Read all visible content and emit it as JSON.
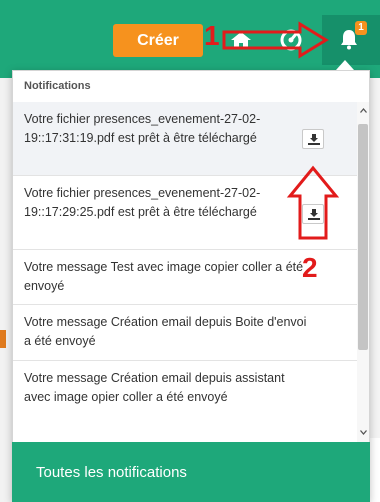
{
  "header": {
    "create_label": "Créer",
    "notification_count": "1",
    "accent": "#1ea87a",
    "create_color": "#f6921e",
    "icons": [
      "home-icon",
      "dashboard-icon",
      "bell-icon"
    ]
  },
  "panel": {
    "title": "Notifications",
    "items": [
      {
        "text": "Votre fichier presences_evenement-27-02-19::17:31:19.pdf est prêt à être téléchargé",
        "has_download": true
      },
      {
        "text": "Votre fichier presences_evenement-27-02-19::17:29:25.pdf est prêt à être téléchargé",
        "has_download": true
      },
      {
        "text": "Votre message Test avec image copier coller a été envoyé",
        "has_download": false
      },
      {
        "text": "Votre message Création email depuis Boite d'envoi a été envoyé",
        "has_download": false
      },
      {
        "text": "Votre message Création email depuis assistant avec image opier coller a été envoyé",
        "has_download": false
      }
    ],
    "footer_label": "Toutes les notifications"
  },
  "annotations": {
    "label_1": "1",
    "label_2": "2",
    "color": "#e21b1b"
  }
}
